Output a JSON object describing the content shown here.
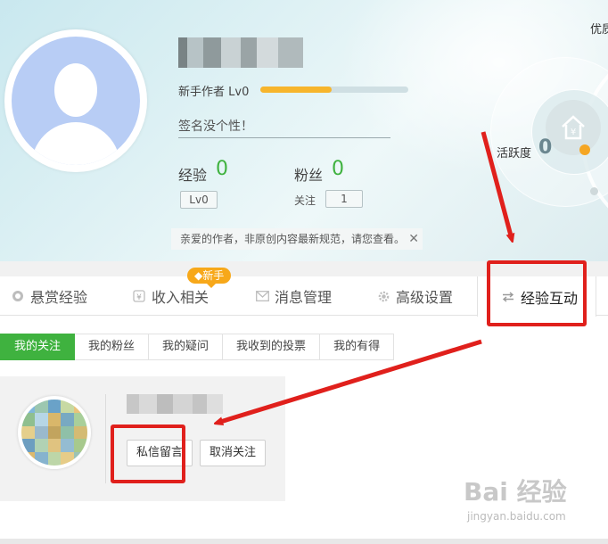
{
  "profile": {
    "username_obscured": "",
    "level_text": "新手作者 Lv0",
    "level_progress": 0.48,
    "signature": "签名没个性！",
    "experience_label": "经验",
    "experience_value": "0",
    "level_badge": "Lv0",
    "fans_label": "粉丝",
    "fans_value": "0",
    "follow_label": "关注",
    "follow_value": "1",
    "notice": "亲爱的作者，非原创内容最新规范，请您查看。",
    "notice_close": "✕"
  },
  "activity": {
    "label": "活跃度",
    "value": "0",
    "top_right_text": "优质"
  },
  "main_tabs": [
    {
      "label": "悬赏经验",
      "icon": "medal-icon"
    },
    {
      "label": "收入相关",
      "icon": "yen-icon"
    },
    {
      "label": "消息管理",
      "icon": "envelope-icon"
    },
    {
      "label": "高级设置",
      "icon": "gear-icon"
    },
    {
      "label": "经验互动",
      "icon": "swap-icon"
    }
  ],
  "new_badge": "新手",
  "sub_tabs": [
    "我的关注",
    "我的粉丝",
    "我的疑问",
    "我收到的投票",
    "我的有得"
  ],
  "follow_card": {
    "message_button": "私信留言",
    "unfollow_button": "取消关注"
  },
  "watermark": {
    "main": "Bai 经验",
    "sub": "jingyan.baidu.com"
  },
  "colors": {
    "accent_green": "#3fb23f",
    "progress_orange": "#f7b52c",
    "annotation_red": "#e0201c"
  }
}
